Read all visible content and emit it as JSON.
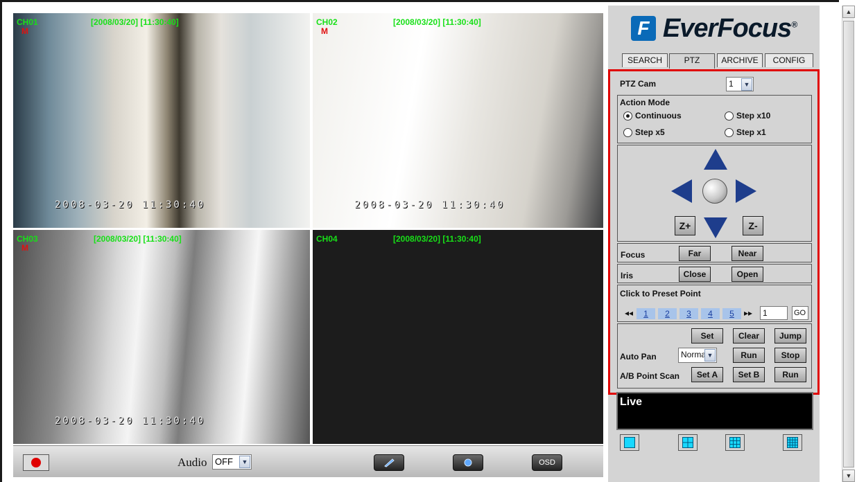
{
  "channels": [
    {
      "label": "CH01",
      "time": "[2008/03/20] [11:30:40]",
      "motion": "M",
      "osd": "2008-03-20  11:30:40"
    },
    {
      "label": "CH02",
      "time": "[2008/03/20] [11:30:40]",
      "motion": "M",
      "osd": "2008-03-20  11:30:40"
    },
    {
      "label": "CH03",
      "time": "[2008/03/20] [11:30:40]",
      "motion": "M",
      "osd": "2008-03-20  11:30:40"
    },
    {
      "label": "CH04",
      "time": "[2008/03/20] [11:30:40]",
      "motion": "",
      "osd": ""
    }
  ],
  "bottombar": {
    "audio_label": "Audio",
    "audio_value": "OFF",
    "osd_label": "OSD",
    "record_icon": "record-icon",
    "snapshot_icon": "pen-icon",
    "camera_icon": "camera-icon"
  },
  "logo": {
    "brand": "EverFocus",
    "mark": "F",
    "registered": "®"
  },
  "tabs": [
    {
      "label": "SEARCH"
    },
    {
      "label": "PTZ"
    },
    {
      "label": "ARCHIVE"
    },
    {
      "label": "CONFIG"
    }
  ],
  "ptz": {
    "cam_label": "PTZ Cam",
    "cam_value": "1",
    "action_mode_label": "Action Mode",
    "modes": [
      "Continuous",
      "Step x10",
      "Step x5",
      "Step x1"
    ],
    "selected_mode": "Continuous",
    "zoom_in": "Z+",
    "zoom_out": "Z-",
    "focus_label": "Focus",
    "focus_far": "Far",
    "focus_near": "Near",
    "iris_label": "Iris",
    "iris_close": "Close",
    "iris_open": "Open",
    "preset_label": "Click to Preset Point",
    "preset_prev": "◂◂",
    "preset_next": "▸▸",
    "presets": [
      "1",
      "2",
      "3",
      "4",
      "5"
    ],
    "preset_input": "1",
    "go": "GO",
    "set": "Set",
    "clear": "Clear",
    "jump": "Jump",
    "auto_pan_label": "Auto Pan",
    "auto_pan_value": "Norma",
    "run": "Run",
    "stop": "Stop",
    "ab_scan_label": "A/B Point Scan",
    "set_a": "Set A",
    "set_b": "Set B",
    "run2": "Run"
  },
  "live": {
    "label": "Live"
  },
  "colors": {
    "accent_red": "#e00000",
    "osd_green": "#18e018",
    "motion_red": "#e01010",
    "arrow_blue": "#1e3d8c"
  }
}
